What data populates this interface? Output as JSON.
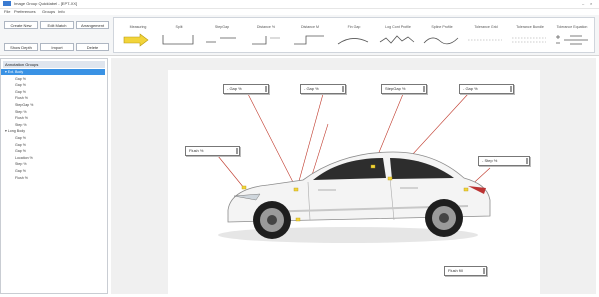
{
  "window": {
    "title": "Image Group Quicklabel - [EPT-XX]",
    "controls": [
      "–",
      "×"
    ]
  },
  "menu": [
    "File",
    "Preferences",
    "Groups",
    "Info"
  ],
  "toolbar": {
    "row1": [
      "Create New",
      "Edit Match",
      "Arrangement"
    ],
    "row2": [
      "Show Depth",
      "Import",
      "Delete"
    ]
  },
  "shapes": [
    {
      "label": "Measuring",
      "icon": "arrow-shape"
    },
    {
      "label": "Split"
    },
    {
      "label": "StepGap"
    },
    {
      "label": "Distance %"
    },
    {
      "label": "Distance M"
    },
    {
      "label": "Fin Gap"
    },
    {
      "label": "Log Cont Profile"
    },
    {
      "label": "Spline Profile"
    },
    {
      "label": "Tolerance Grid"
    },
    {
      "label": "Tolerance Bundle"
    },
    {
      "label": "Tolerance Equation"
    }
  ],
  "tree": {
    "header": "Annotation Groups",
    "items": [
      {
        "text": "▾ Ext. Body",
        "level": 0,
        "selected": true
      },
      {
        "text": "Gap %",
        "level": 1
      },
      {
        "text": "Gap %",
        "level": 1
      },
      {
        "text": "Gap %",
        "level": 1
      },
      {
        "text": "Flush %",
        "level": 1
      },
      {
        "text": "StepGap %",
        "level": 1
      },
      {
        "text": "Step %",
        "level": 1
      },
      {
        "text": "Flush %",
        "level": 1
      },
      {
        "text": "Step %",
        "level": 1
      },
      {
        "text": "▾ Long Body",
        "level": 0
      },
      {
        "text": "Gap %",
        "level": 1
      },
      {
        "text": "Gap %",
        "level": 1
      },
      {
        "text": "Gap %",
        "level": 1
      },
      {
        "text": "Location %",
        "level": 1
      },
      {
        "text": "Step %",
        "level": 1
      },
      {
        "text": "Gap %",
        "level": 1
      },
      {
        "text": "Flush %",
        "level": 1
      }
    ]
  },
  "callouts": [
    {
      "text": "- Gap %"
    },
    {
      "text": "- Gap %"
    },
    {
      "text": "StepGap %"
    },
    {
      "text": "- Gap %"
    },
    {
      "text": "Flush %"
    },
    {
      "text": "- Step %"
    },
    {
      "text": "Flush fill"
    }
  ],
  "colors": {
    "accent": "#3a92e4",
    "leader": "#c0392b",
    "marker": "#f2d43a"
  }
}
